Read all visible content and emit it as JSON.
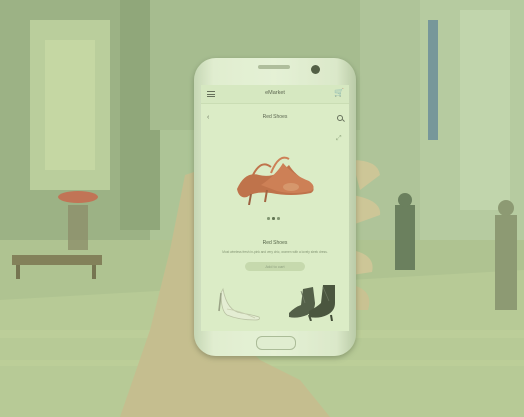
{
  "app": {
    "title": "eMarket"
  },
  "page": {
    "title": "Red Shoes"
  },
  "product": {
    "name": "Red Shoes",
    "description": "Most wireless fresh in-pink and very chic, women with a lovely sleek dress.",
    "add_to_cart_label": "Add to cart"
  },
  "carousel": {
    "slide_count": 3,
    "active_index": 1
  },
  "icons": {
    "menu": "menu-icon",
    "cart": "cart-icon",
    "back": "chevron-left-icon",
    "search": "search-icon",
    "expand": "expand-icon"
  },
  "colors": {
    "overlay_tint": "#bee196",
    "screen_bg": "#e6f0d8",
    "product_red": "#c0482f"
  }
}
